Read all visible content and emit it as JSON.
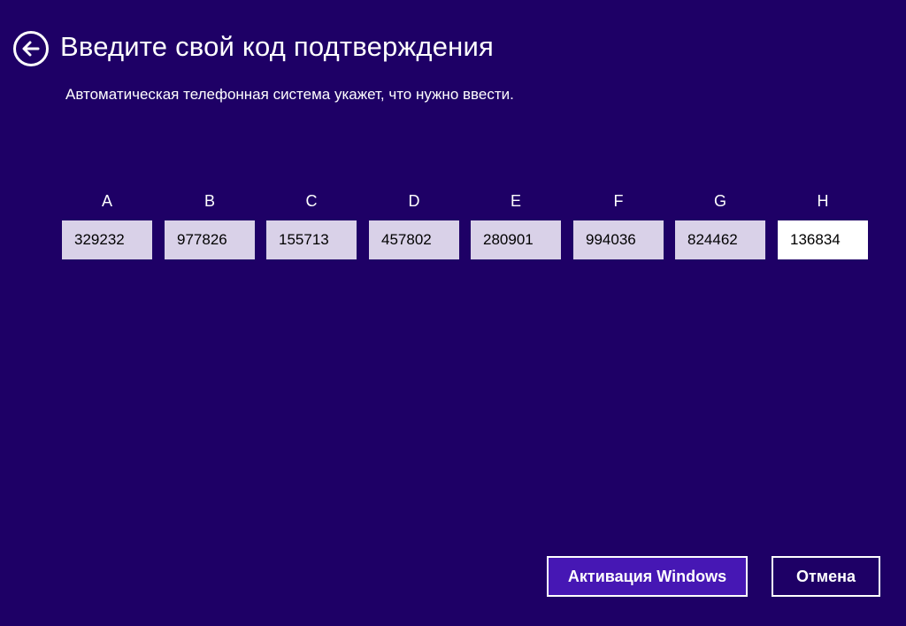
{
  "header": {
    "back_icon": "back-arrow-icon",
    "title": "Введите свой код подтверждения",
    "subtitle": "Автоматическая телефонная система укажет, что нужно ввести."
  },
  "codes": [
    {
      "label": "A",
      "value": "329232"
    },
    {
      "label": "B",
      "value": "977826"
    },
    {
      "label": "C",
      "value": "155713"
    },
    {
      "label": "D",
      "value": "457802"
    },
    {
      "label": "E",
      "value": "280901"
    },
    {
      "label": "F",
      "value": "994036"
    },
    {
      "label": "G",
      "value": "824462"
    },
    {
      "label": "H",
      "value": "136834"
    }
  ],
  "buttons": {
    "activate": "Активация Windows",
    "cancel": "Отмена"
  },
  "colors": {
    "background": "#1e0066",
    "accent": "#4617b4",
    "field_readonly": "#d9d1e8",
    "field_active": "#ffffff"
  }
}
